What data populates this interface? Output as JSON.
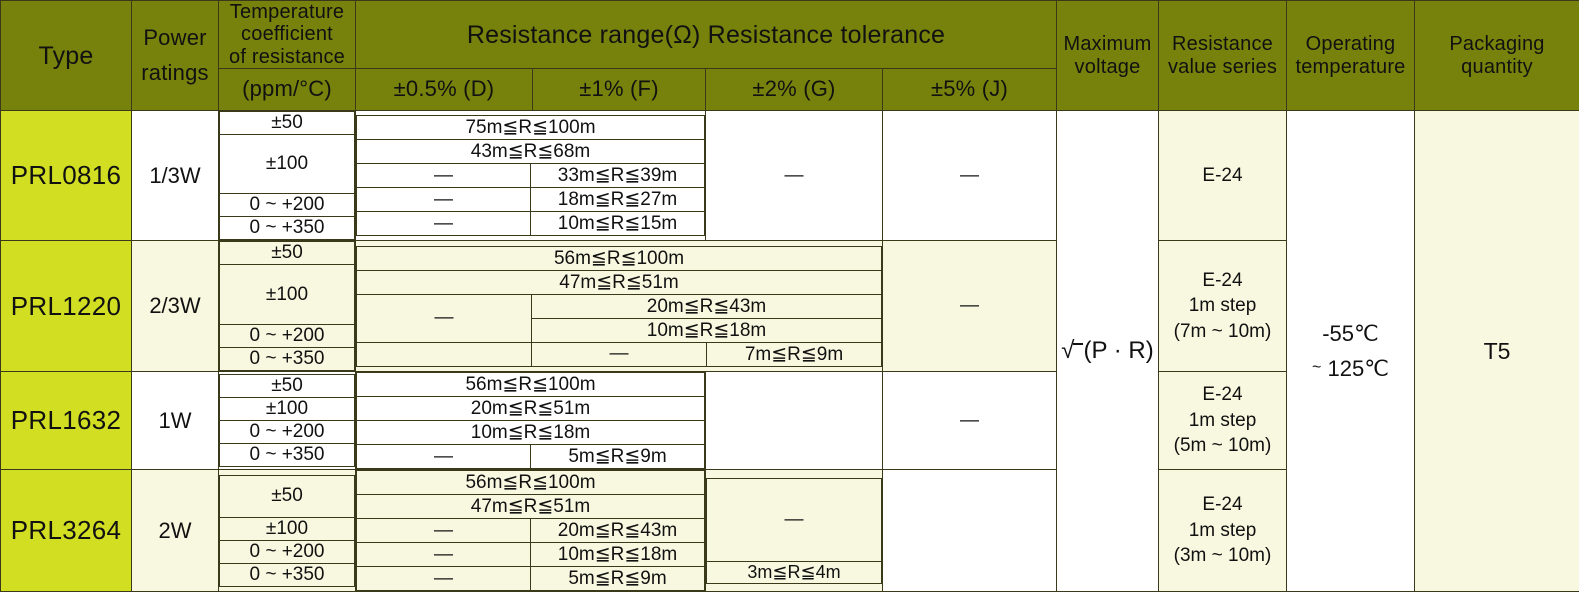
{
  "header": {
    "type": "Type",
    "power_ratings": "Power\nratings",
    "tcr_title": "Temperature\ncoefficient\nof resistance",
    "tcr_unit": "(ppm/°C)",
    "range_title": "Resistance range(Ω) Resistance tolerance",
    "tol_d": "±0.5% (D)",
    "tol_f": "±1% (F)",
    "tol_g": "±2% (G)",
    "tol_j": "±5% (J)",
    "max_voltage": "Maximum\nvoltage",
    "resistance_series": "Resistance\nvalue series",
    "operating_temperature": "Operating\ntemperature",
    "packaging_quantity": "Packaging\nquantity"
  },
  "shared": {
    "max_voltage_value": "(P · R)",
    "operating_temp_low": "-55℃",
    "operating_temp_high": "125℃",
    "operating_temp_tilde": "~",
    "packaging_value": "T5",
    "dash": "—"
  },
  "rows": [
    {
      "type": "PRL0816",
      "power": "1/3W",
      "tcr": [
        "±50",
        "±100",
        "0 ~ +200",
        "0 ~ +350"
      ],
      "ranges": {
        "r1_df": "75m≦R≦100m",
        "r2_df": "43m≦R≦68m",
        "r3_d": "—",
        "r3_f": "33m≦R≦39m",
        "r4_d": "—",
        "r4_f": "18m≦R≦27m",
        "r5_d": "—",
        "r5_f": "10m≦R≦15m"
      },
      "g": "—",
      "j": "—",
      "series": "E-24",
      "series_step": "",
      "series_range": ""
    },
    {
      "type": "PRL1220",
      "power": "2/3W",
      "tcr": [
        "±50",
        "±100",
        "0 ~ +200",
        "0 ~ +350"
      ],
      "ranges": {
        "r1_df": "56m≦R≦100m",
        "r2_df": "47m≦R≦51m",
        "r3_d": "—",
        "r3_f": "20m≦R≦43m",
        "r4_d": "—",
        "r4_f": "10m≦R≦18m",
        "r5_f": "—",
        "r5_g": "7m≦R≦9m"
      },
      "j": "—",
      "series": "E-24",
      "series_step": "1m step",
      "series_range": "(7m ~ 10m)"
    },
    {
      "type": "PRL1632",
      "power": "1W",
      "tcr": [
        "±50",
        "±100",
        "0 ~ +200",
        "0 ~ +350"
      ],
      "ranges": {
        "r1_df": "56m≦R≦100m",
        "r2_df": "20m≦R≦51m",
        "r3_df": "10m≦R≦18m",
        "r4_d": "—",
        "r4_f": "5m≦R≦9m"
      },
      "j": "—",
      "series": "E-24",
      "series_step": "1m step",
      "series_range": "(5m ~ 10m)"
    },
    {
      "type": "PRL3264",
      "power": "2W",
      "tcr": [
        "±50",
        "±100",
        "0 ~ +200",
        "0 ~ +350"
      ],
      "ranges": {
        "r1_df": "56m≦R≦100m",
        "r2_df": "47m≦R≦51m",
        "r3_d": "—",
        "r3_f": "20m≦R≦43m",
        "r4_d": "—",
        "r4_f": "10m≦R≦18m",
        "r5_d": "—",
        "r5_f": "5m≦R≦9m"
      },
      "g_top": "—",
      "g_bottom": "3m≦R≦4m",
      "series": "E-24",
      "series_step": "1m step",
      "series_range": "(3m ~ 10m)"
    }
  ]
}
